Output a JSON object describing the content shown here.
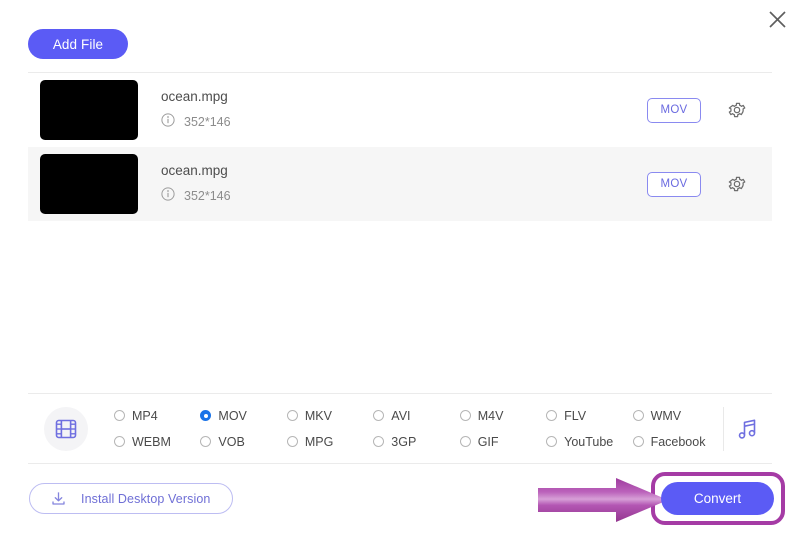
{
  "window": {
    "close_icon": "close-icon"
  },
  "toolbar": {
    "add_file_label": "Add File"
  },
  "file_list": {
    "rows": [
      {
        "thumbnail": "video-thumbnail",
        "name": "ocean.mpg",
        "info_icon": "info-icon",
        "dimensions": "352*146",
        "output_format": "MOV",
        "settings_icon": "gear-icon"
      },
      {
        "thumbnail": "video-thumbnail",
        "name": "ocean.mpg",
        "info_icon": "info-icon",
        "dimensions": "352*146",
        "output_format": "MOV",
        "settings_icon": "gear-icon"
      }
    ]
  },
  "format_bar": {
    "video_icon": "film-strip-icon",
    "audio_icon": "music-note-icon",
    "selected_format": "MOV",
    "options": [
      {
        "label": "MP4",
        "checked": false
      },
      {
        "label": "MOV",
        "checked": true
      },
      {
        "label": "MKV",
        "checked": false
      },
      {
        "label": "AVI",
        "checked": false
      },
      {
        "label": "M4V",
        "checked": false
      },
      {
        "label": "FLV",
        "checked": false
      },
      {
        "label": "WMV",
        "checked": false
      },
      {
        "label": "WEBM",
        "checked": false
      },
      {
        "label": "VOB",
        "checked": false
      },
      {
        "label": "MPG",
        "checked": false
      },
      {
        "label": "3GP",
        "checked": false
      },
      {
        "label": "GIF",
        "checked": false
      },
      {
        "label": "YouTube",
        "checked": false
      },
      {
        "label": "Facebook",
        "checked": false
      }
    ]
  },
  "bottom_bar": {
    "install_label": "Install Desktop Version",
    "install_icon": "download-icon",
    "convert_label": "Convert"
  },
  "annotation": {
    "arrow_icon": "annotation-arrow-icon",
    "highlight_icon": "annotation-highlight-ring",
    "color": "#a53ba5",
    "points_to": "Convert"
  },
  "colors": {
    "accent": "#5b5bf5",
    "chip_border": "#8a8af0",
    "radio_selected": "#1a73e8",
    "row_alt_bg": "#f6f6f6",
    "divider": "#ebebeb",
    "annotation": "#a53ba5"
  }
}
